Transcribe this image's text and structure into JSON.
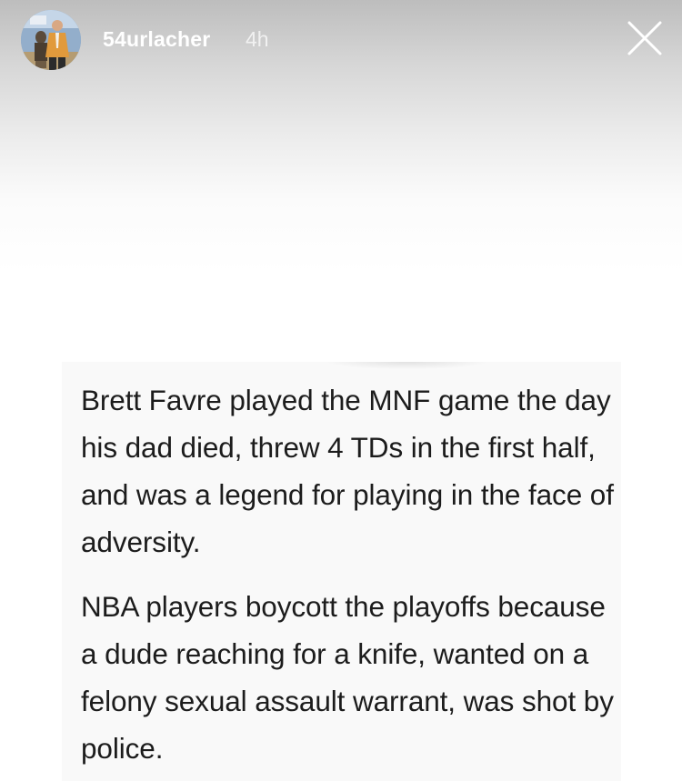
{
  "header": {
    "username": "54urlacher",
    "timestamp": "4h"
  },
  "post": {
    "paragraph_1": "Brett Favre played the MNF game the day his dad died, threw 4 TDs in the first half, and was a legend for playing in the face of adversity.",
    "paragraph_2": "NBA players boycott the playoffs because a dude reaching for a knife, wanted on a felony sexual assault warrant, was shot by police."
  },
  "icons": {
    "avatar": "profile-photo",
    "close": "close-x-icon"
  },
  "colors": {
    "header_text": "#ffffff",
    "card_background": "#f9f9f9",
    "post_text": "#1c1c1c"
  }
}
